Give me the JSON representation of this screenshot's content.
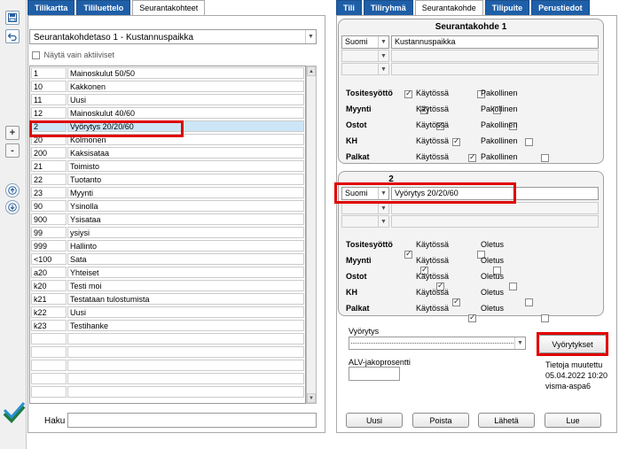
{
  "left_tabs": [
    "Tilikartta",
    "Tililuettelo",
    "Seurantakohteet"
  ],
  "right_tabs": [
    "Tili",
    "Tiliryhmä",
    "Seurantakohde",
    "Tilipuite",
    "Perustiedot"
  ],
  "level_select": "Seurantakohdetaso 1 - Kustannuspaikka",
  "show_active_label": "Näytä vain aktiiviset",
  "list_rows": [
    {
      "code": "1",
      "name": "Mainoskulut 50/50"
    },
    {
      "code": "10",
      "name": "Kakkonen"
    },
    {
      "code": "11",
      "name": "Uusi"
    },
    {
      "code": "12",
      "name": "Mainoskulut 40/60"
    },
    {
      "code": "2",
      "name": "Vyörytys 20/20/60"
    },
    {
      "code": "20",
      "name": "Kolmonen"
    },
    {
      "code": "200",
      "name": "Kaksisataa"
    },
    {
      "code": "21",
      "name": "Toimisto"
    },
    {
      "code": "22",
      "name": "Tuotanto"
    },
    {
      "code": "23",
      "name": "Myynti"
    },
    {
      "code": "90",
      "name": "Ysinolla"
    },
    {
      "code": "900",
      "name": "Ysisataa"
    },
    {
      "code": "99",
      "name": "ysiysi"
    },
    {
      "code": "999",
      "name": "Hallinto"
    },
    {
      "code": "<100",
      "name": "Sata"
    },
    {
      "code": "a20",
      "name": "Yhteiset"
    },
    {
      "code": "k20",
      "name": "Testi moi"
    },
    {
      "code": "k21",
      "name": "Testataan tulostumista"
    },
    {
      "code": "k22",
      "name": "Uusi"
    },
    {
      "code": "k23",
      "name": "Testihanke"
    },
    {
      "code": "",
      "name": ""
    },
    {
      "code": "",
      "name": ""
    },
    {
      "code": "",
      "name": ""
    },
    {
      "code": "",
      "name": ""
    },
    {
      "code": "",
      "name": ""
    }
  ],
  "search_label": "Haku",
  "group1": {
    "title": "Seurantakohde 1",
    "language": "Suomi",
    "name_value": "Kustannuspaikka",
    "rows": [
      {
        "label": "Tositesyöttö",
        "enabled": "Käytössä",
        "second": "Pakollinen"
      },
      {
        "label": "Myynti",
        "enabled": "Käytössä",
        "second": "Pakollinen"
      },
      {
        "label": "Ostot",
        "enabled": "Käytössä",
        "second": "Pakollinen"
      },
      {
        "label": "KH",
        "enabled": "Käytössä",
        "second": "Pakollinen"
      },
      {
        "label": "Palkat",
        "enabled": "Käytössä",
        "second": "Pakollinen"
      }
    ]
  },
  "group2": {
    "title": "2",
    "language": "Suomi",
    "name_value": "Vyörytys 20/20/60",
    "rows": [
      {
        "label": "Tositesyöttö",
        "enabled": "Käytössä",
        "second": "Oletus"
      },
      {
        "label": "Myynti",
        "enabled": "Käytössä",
        "second": "Oletus"
      },
      {
        "label": "Ostot",
        "enabled": "Käytössä",
        "second": "Oletus"
      },
      {
        "label": "KH",
        "enabled": "Käytössä",
        "second": "Oletus"
      },
      {
        "label": "Palkat",
        "enabled": "Käytössä",
        "second": "Oletus"
      }
    ]
  },
  "allocation_label": "Vyörytys",
  "allocations_button": "Vyörytykset",
  "vat_label": "ALV-jakoprosentti",
  "info_changed": "Tietoja muutettu",
  "info_date": "05.04.2022 10:20",
  "info_user": "visma-aspa6",
  "buttons": {
    "new": "Uusi",
    "delete": "Poista",
    "send": "Lähetä",
    "read": "Lue"
  },
  "colors": {
    "tab_blue": "#1f5fa8",
    "highlight": "#e00000",
    "selected_row": "#cde6f7"
  }
}
